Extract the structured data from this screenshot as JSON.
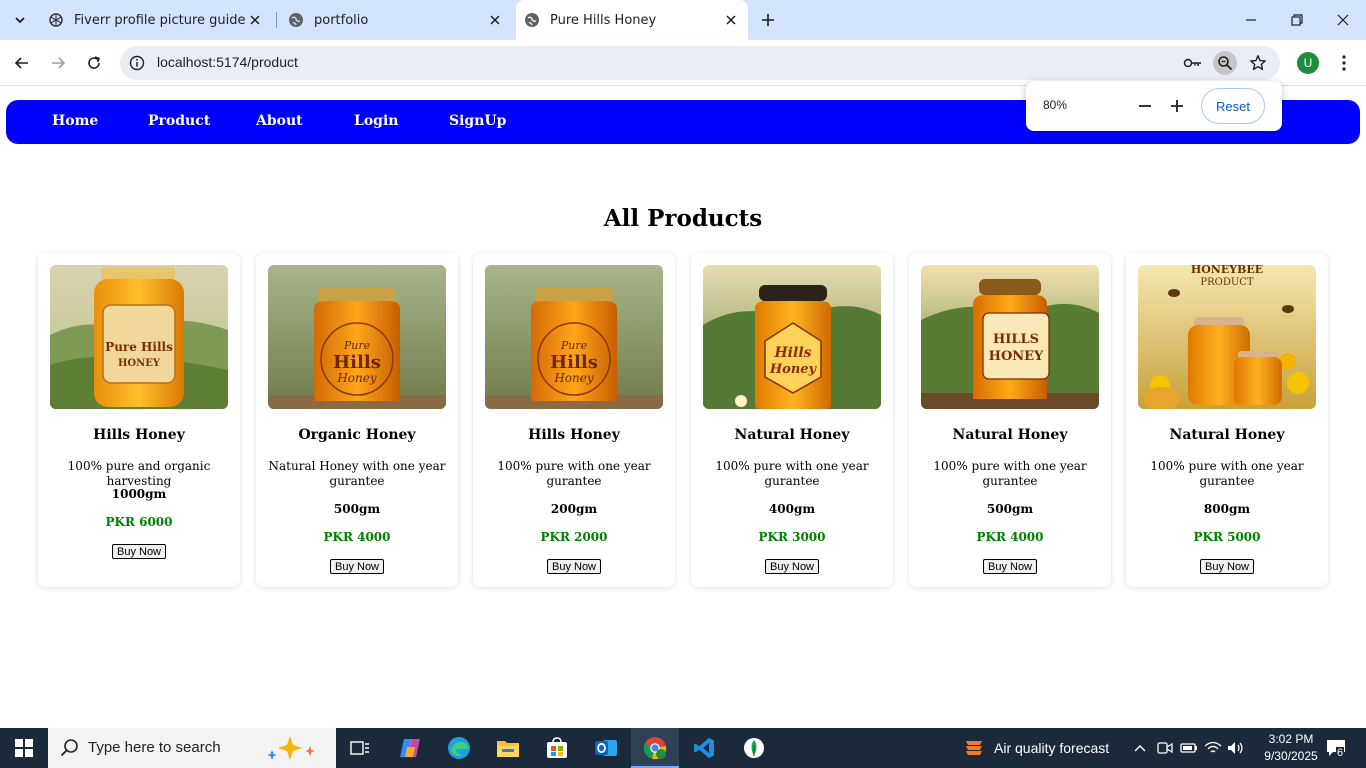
{
  "browser": {
    "tabs": [
      {
        "title": "Fiverr profile picture guide",
        "icon": "openai-icon"
      },
      {
        "title": "portfolio",
        "icon": "globe-icon"
      },
      {
        "title": "Pure Hills Honey",
        "icon": "globe-icon"
      }
    ],
    "url": "localhost:5174/product",
    "profile_initial": "U",
    "zoom": {
      "value": "80%",
      "reset_label": "Reset"
    }
  },
  "nav": {
    "items": [
      "Home",
      "Product",
      "About",
      "Login",
      "SignUp"
    ],
    "color": "#0000ff"
  },
  "page": {
    "heading": "All Products",
    "price_color": "#008000"
  },
  "products": [
    {
      "name": "Hills Honey",
      "desc": "100% pure and organic harvesting",
      "weight": "1000gm",
      "price": "PKR 6000",
      "button": "Buy Now",
      "jar_label": [
        "Pure Hills",
        "HONEY"
      ]
    },
    {
      "name": "Organic Honey",
      "desc": "Natural Honey with one year gurantee",
      "weight": "500gm",
      "price": "PKR 4000",
      "button": "Buy Now",
      "jar_label": [
        "Pure",
        "Hills",
        "Honey"
      ]
    },
    {
      "name": "Hills Honey",
      "desc": "100% pure with one year gurantee",
      "weight": "200gm",
      "price": "PKR 2000",
      "button": "Buy Now",
      "jar_label": [
        "Pure",
        "Hills",
        "Honey"
      ]
    },
    {
      "name": "Natural Honey",
      "desc": "100% pure with one year gurantee",
      "weight": "400gm",
      "price": "PKR 3000",
      "button": "Buy Now",
      "jar_label": [
        "Hills",
        "Honey"
      ]
    },
    {
      "name": "Natural Honey",
      "desc": "100% pure with one year gurantee",
      "weight": "500gm",
      "price": "PKR 4000",
      "button": "Buy Now",
      "jar_label": [
        "HILLS",
        "HONEY"
      ]
    },
    {
      "name": "Natural Honey",
      "desc": "100% pure with one year gurantee",
      "weight": "800gm",
      "price": "PKR 5000",
      "button": "Buy Now",
      "jar_label": [
        "HONEYBEE",
        "PRODUCT"
      ]
    }
  ],
  "taskbar": {
    "search_placeholder": "Type here to search",
    "weather": "Air quality forecast",
    "time": "3:02 PM",
    "date": "9/30/2025",
    "notifications": "6"
  }
}
